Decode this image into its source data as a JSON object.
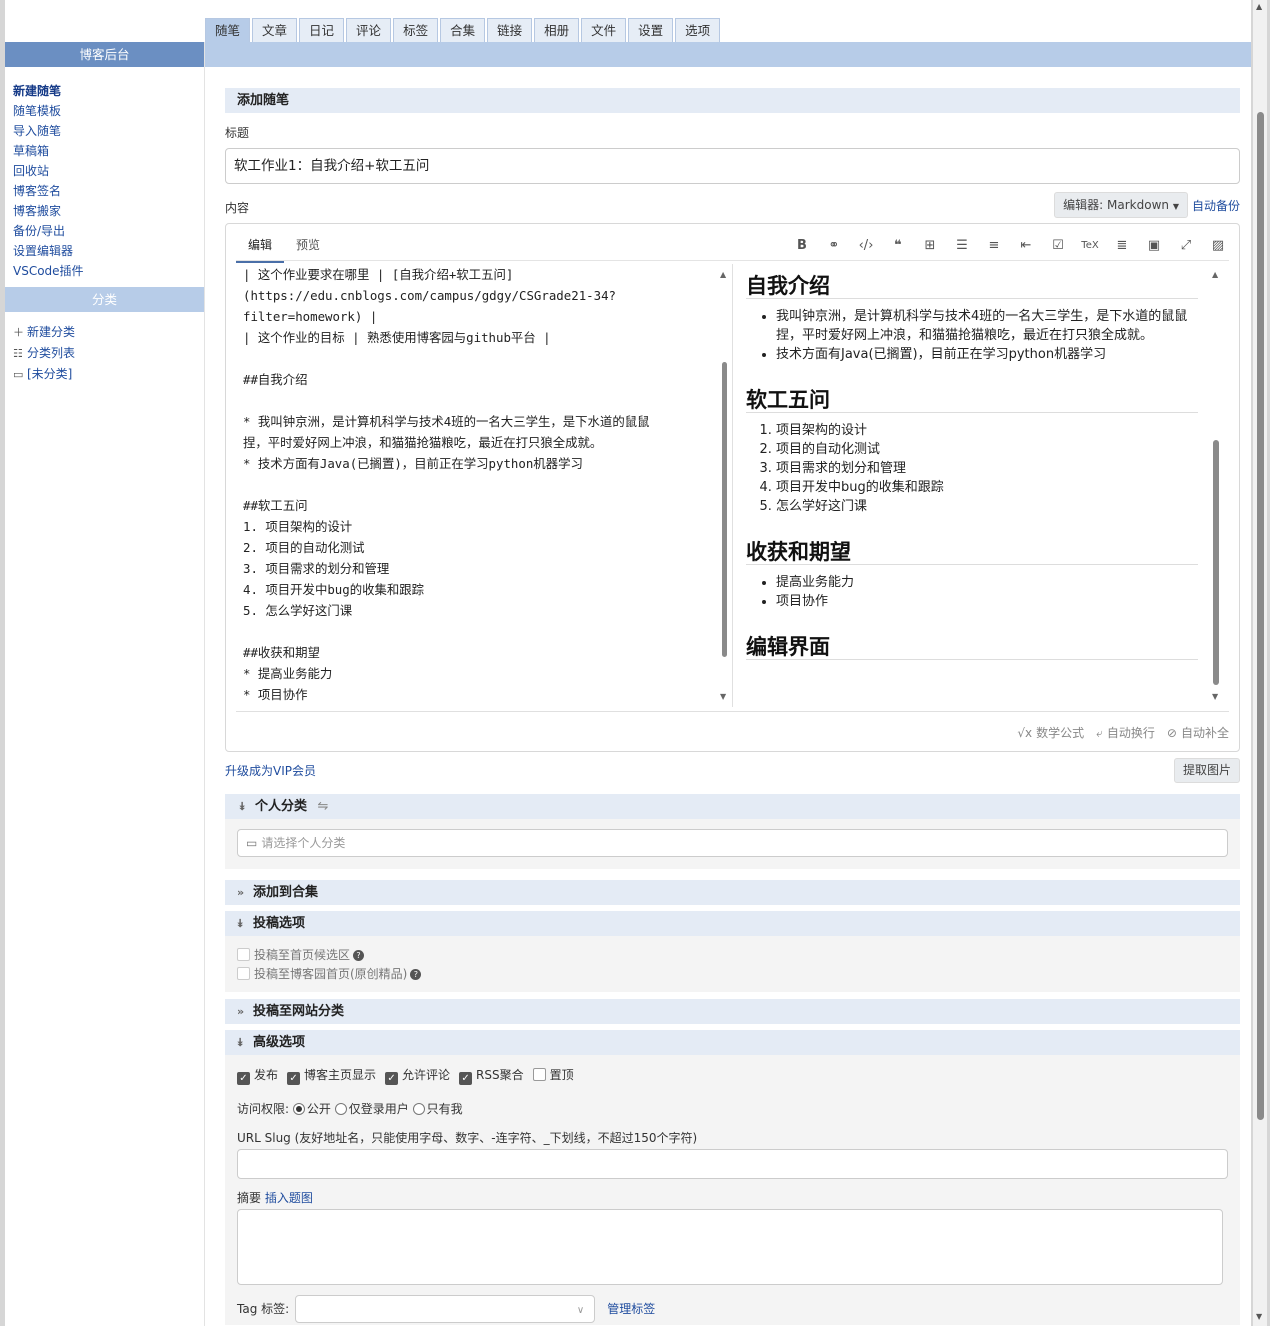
{
  "tabs": [
    "随笔",
    "文章",
    "日记",
    "评论",
    "标签",
    "合集",
    "链接",
    "相册",
    "文件",
    "设置",
    "选项"
  ],
  "sidebar": {
    "title": "博客后台",
    "links": [
      "新建随笔",
      "随笔模板",
      "导入随笔",
      "草稿箱",
      "回收站",
      "博客签名",
      "博客搬家",
      "备份/导出",
      "设置编辑器",
      "VSCode插件"
    ],
    "category_title": "分类",
    "category_links": [
      {
        "icon": "plus-icon",
        "label": "新建分类"
      },
      {
        "icon": "list-icon",
        "label": "分类列表"
      },
      {
        "icon": "folder-icon",
        "label": "[未分类]"
      }
    ]
  },
  "form": {
    "section_title": "添加随笔",
    "title_label": "标题",
    "title_value": "软工作业1：自我介绍+软工五问",
    "content_label": "内容",
    "editor_button": "编辑器: Markdown",
    "auto_backup": "自动备份"
  },
  "editor": {
    "tab_edit": "编辑",
    "tab_preview": "预览",
    "toolbar": [
      "bold-icon",
      "link-icon",
      "code-icon",
      "quote-icon",
      "table-icon",
      "unordered-list-icon",
      "ordered-list-icon",
      "outdent-icon",
      "task-list-icon",
      "tex-icon",
      "align-icon",
      "save-icon",
      "fullscreen-icon",
      "image-icon"
    ],
    "source_lines": [
      "| 这个作业要求在哪里 | [自我介绍+软工五问]",
      "(https://edu.cnblogs.com/campus/gdgy/CSGrade21-34?",
      "filter=homework) |",
      "| 这个作业的目标 | 熟悉使用博客园与github平台 |",
      "",
      "##自我介绍",
      "",
      "* 我叫钟京洲，是计算机科学与技术4班的一名大三学生，是下水道的鼠鼠",
      "捏，平时爱好网上冲浪，和猫猫抢猫粮吃，最近在打只狼全成就。",
      "* 技术方面有Java(已搁置)，目前正在学习python机器学习",
      "",
      "##软工五问",
      "1. 项目架构的设计",
      "2. 项目的自动化测试",
      "3. 项目需求的划分和管理",
      "4. 项目开发中bug的收集和跟踪",
      "5. 怎么学好这门课",
      "",
      "##收获和期望",
      "* 提高业务能力",
      "* 项目协作"
    ],
    "preview": {
      "h1": "自我介绍",
      "intro_items": [
        "我叫钟京洲，是计算机科学与技术4班的一名大三学生，是下水道的鼠鼠捏，平时爱好网上冲浪，和猫猫抢猫粮吃，最近在打只狼全成就。",
        "技术方面有Java(已搁置)，目前正在学习python机器学习"
      ],
      "h2": "软工五问",
      "questions": [
        "项目架构的设计",
        "项目的自动化测试",
        "项目需求的划分和管理",
        "项目开发中bug的收集和跟踪",
        "怎么学好这门课"
      ],
      "h3": "收获和期望",
      "goals": [
        "提高业务能力",
        "项目协作"
      ],
      "h4": "编辑界面"
    },
    "footer": {
      "math": "数学公式",
      "wrap": "自动换行",
      "complete": "自动补全"
    }
  },
  "below": {
    "vip_link": "升级成为VIP会员",
    "extract_images": "提取图片",
    "personal_category": "个人分类",
    "category_placeholder": "请选择个人分类",
    "add_collection": "添加到合集",
    "submit_options": "投稿选项",
    "submit_home_candidate": "投稿至首页候选区",
    "submit_home_original": "投稿至博客园首页(原创精品)",
    "submit_site_category": "投稿至网站分类",
    "advanced": "高级选项",
    "checks": [
      {
        "label": "发布",
        "checked": true
      },
      {
        "label": "博客主页显示",
        "checked": true
      },
      {
        "label": "允许评论",
        "checked": true
      },
      {
        "label": "RSS聚合",
        "checked": true
      },
      {
        "label": "置顶",
        "checked": false
      }
    ],
    "access_label": "访问权限:",
    "access_options": [
      {
        "label": "公开",
        "checked": true
      },
      {
        "label": "仅登录用户",
        "checked": false
      },
      {
        "label": "只有我",
        "checked": false
      }
    ],
    "slug_label": "URL Slug (友好地址名，只能使用字母、数字、-连字符、_下划线，不超过150个字符)",
    "summary_label": "摘要",
    "insert_image": "插入题图",
    "tag_label": "Tag 标签:",
    "manage_tags": "管理标签"
  }
}
